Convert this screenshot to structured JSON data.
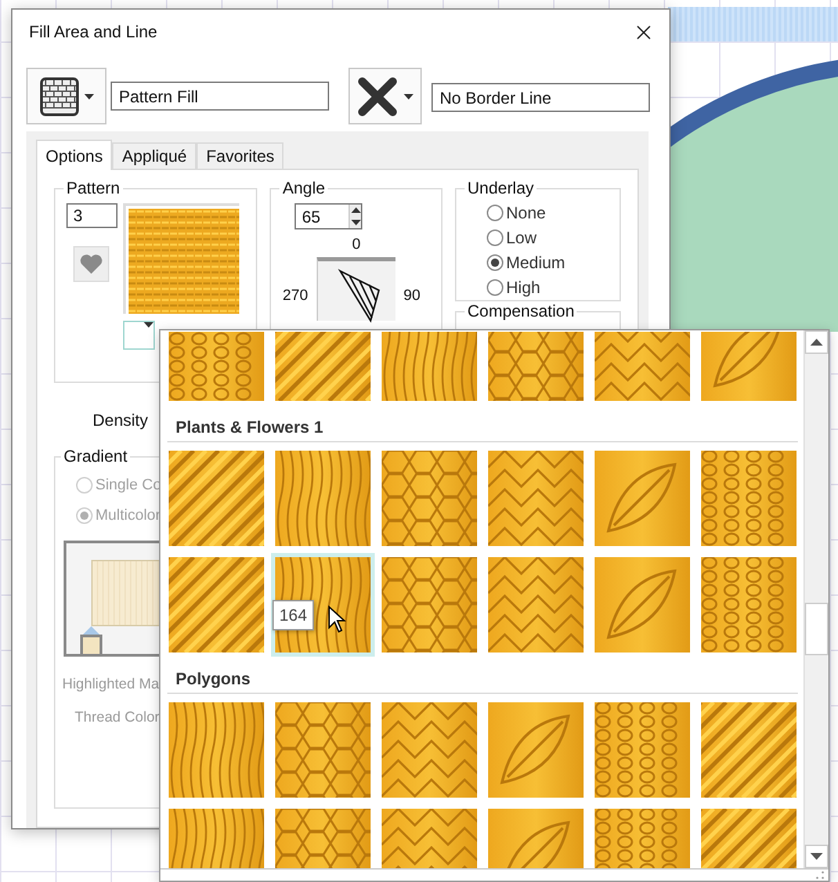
{
  "window": {
    "title": "Fill Area and Line"
  },
  "fill": {
    "value": "Pattern Fill"
  },
  "border": {
    "value": "No Border Line"
  },
  "tabs": [
    {
      "label": "Options",
      "selected": true
    },
    {
      "label": "Appliqué",
      "selected": false
    },
    {
      "label": "Favorites",
      "selected": false
    }
  ],
  "pattern": {
    "title": "Pattern",
    "number": "3"
  },
  "angle": {
    "title": "Angle",
    "value": "65",
    "top_mark": "0",
    "left_mark": "270",
    "right_mark": "90"
  },
  "underlay": {
    "title": "Underlay",
    "options": [
      {
        "label": "None",
        "selected": false
      },
      {
        "label": "Low",
        "selected": false
      },
      {
        "label": "Medium",
        "selected": true
      },
      {
        "label": "High",
        "selected": false
      }
    ]
  },
  "compensation": {
    "title": "Compensation"
  },
  "density": {
    "label": "Density"
  },
  "gradient": {
    "title": "Gradient",
    "modes": [
      {
        "label": "Single Co",
        "selected": false,
        "disabled": true
      },
      {
        "label": "Multicolor",
        "selected": true,
        "disabled": true
      }
    ],
    "highlighted_label": "Highlighted Ma",
    "thread_color_label": "Thread Color"
  },
  "pattern_picker": {
    "tooltip": "164",
    "sections": [
      {
        "tiles": [
          {
            "selected": false
          },
          {
            "selected": false
          },
          {
            "selected": false
          },
          {
            "selected": false
          },
          {
            "selected": false
          },
          {
            "selected": false
          }
        ]
      },
      {
        "title": "Plants & Flowers 1",
        "tiles": [
          {
            "selected": false
          },
          {
            "selected": false
          },
          {
            "selected": false
          },
          {
            "selected": false
          },
          {
            "selected": false
          },
          {
            "selected": false
          },
          {
            "selected": false
          },
          {
            "selected": true
          },
          {
            "selected": false
          },
          {
            "selected": false
          },
          {
            "selected": false
          },
          {
            "selected": false
          }
        ]
      },
      {
        "title": "Polygons",
        "tiles": [
          {
            "selected": false
          },
          {
            "selected": false
          },
          {
            "selected": false
          },
          {
            "selected": false
          },
          {
            "selected": false
          },
          {
            "selected": false
          },
          {
            "selected": false
          },
          {
            "selected": false
          },
          {
            "selected": false
          },
          {
            "selected": false
          },
          {
            "selected": false
          },
          {
            "selected": false
          }
        ]
      }
    ]
  }
}
